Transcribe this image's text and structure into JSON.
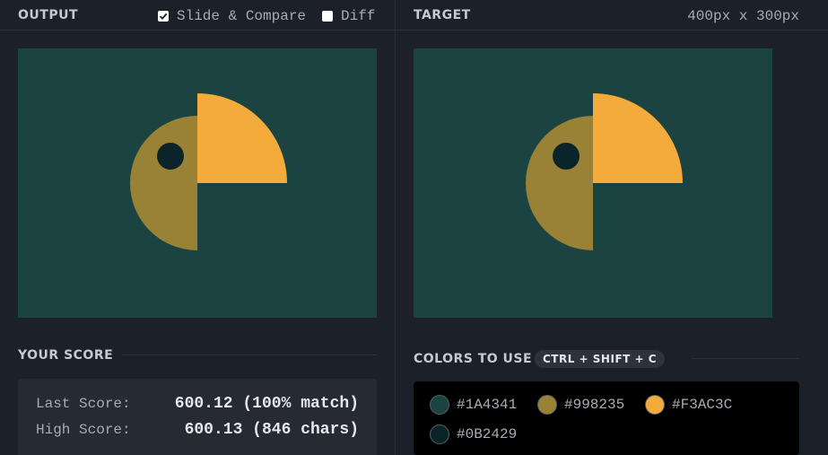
{
  "output": {
    "title": "OUTPUT",
    "slide_compare_label": "Slide & Compare",
    "slide_compare_checked": true,
    "diff_label": "Diff",
    "diff_checked": false
  },
  "target": {
    "title": "TARGET",
    "dimensions": "400px x 300px"
  },
  "score": {
    "title": "YOUR SCORE",
    "last_label": "Last Score:",
    "last_value": "600.12 (100% match)",
    "high_label": "High Score:",
    "high_value": "600.13 (846 chars)"
  },
  "colors": {
    "title": "COLORS TO USE",
    "shortcut": "CTRL + SHIFT + C",
    "swatches": [
      {
        "hex": "#1A4341",
        "label": "#1A4341"
      },
      {
        "hex": "#998235",
        "label": "#998235"
      },
      {
        "hex": "#F3AC3C",
        "label": "#F3AC3C"
      },
      {
        "hex": "#0B2429",
        "label": "#0B2429"
      }
    ]
  },
  "palette": {
    "background": "#1A4341",
    "body": "#998235",
    "beak": "#F3AC3C",
    "eye": "#0B2429"
  }
}
